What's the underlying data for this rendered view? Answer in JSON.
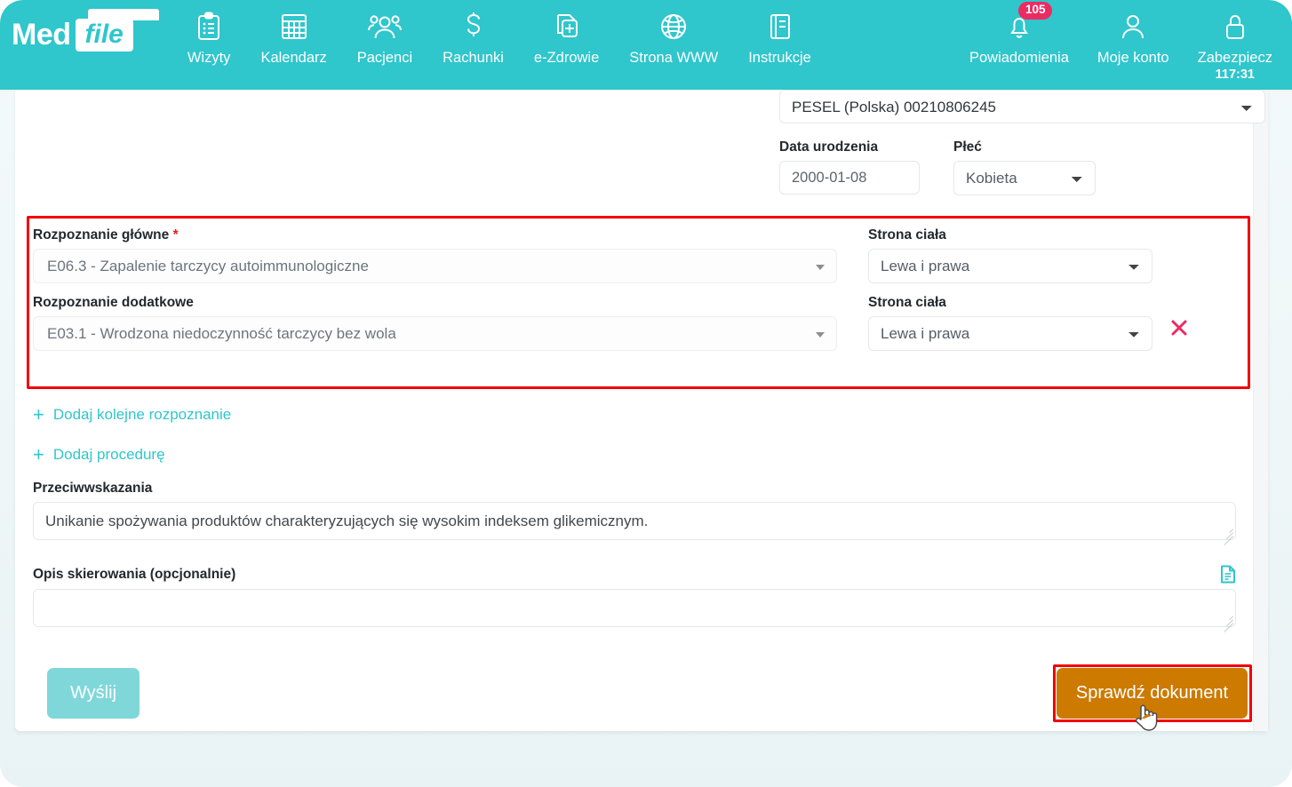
{
  "header": {
    "brand_med": "Med",
    "brand_file": "file",
    "nav": [
      {
        "label": "Wizyty",
        "icon": "clipboard-icon"
      },
      {
        "label": "Kalendarz",
        "icon": "calendar-icon"
      },
      {
        "label": "Pacjenci",
        "icon": "users-icon"
      },
      {
        "label": "Rachunki",
        "icon": "dollar-icon"
      },
      {
        "label": "e-Zdrowie",
        "icon": "medical-file-icon"
      },
      {
        "label": "Strona WWW",
        "icon": "globe-icon"
      },
      {
        "label": "Instrukcje",
        "icon": "book-icon"
      }
    ],
    "right": {
      "notifications_label": "Powiadomienia",
      "notifications_count": "105",
      "account_label": "Moje konto",
      "secure_label": "Zabezpiecz",
      "secure_timer": "117:31"
    },
    "colors": {
      "teal": "#2fc6cc",
      "badge": "#ec2b63"
    }
  },
  "patient": {
    "pesel_value": "PESEL (Polska) 00210806245",
    "dob_label": "Data urodzenia",
    "dob_value": "2000-01-08",
    "sex_label": "Płeć",
    "sex_value": "Kobieta"
  },
  "diagnosis": {
    "main_label": "Rozpoznanie główne",
    "main_required_mark": "*",
    "main_value": "E06.3 - Zapalenie tarczycy autoimmunologiczne",
    "main_side_label": "Strona ciała",
    "main_side_value": "Lewa i prawa",
    "extra_label": "Rozpoznanie dodatkowe",
    "extra_value": "E03.1 - Wrodzona niedoczynność tarczycy bez wola",
    "extra_side_label": "Strona ciała",
    "extra_side_value": "Lewa i prawa",
    "remove_icon": "close-x-icon",
    "highlight_color": "#f20000"
  },
  "links": {
    "add_diagnosis": "Dodaj kolejne rozpoznanie",
    "add_procedure": "Dodaj procedurę",
    "plus": "+"
  },
  "contraindications": {
    "label": "Przeciwwskazania",
    "value": "Unikanie spożywania produktów charakteryzujących się wysokim indeksem glikemicznym."
  },
  "referral_description": {
    "label": "Opis skierowania (opcjonalnie)",
    "value": "",
    "icon": "document-icon"
  },
  "actions": {
    "send_label": "Wyślij",
    "check_label": "Sprawdź dokument",
    "send_color": "#7fd7da",
    "check_color": "#cc7a00"
  }
}
